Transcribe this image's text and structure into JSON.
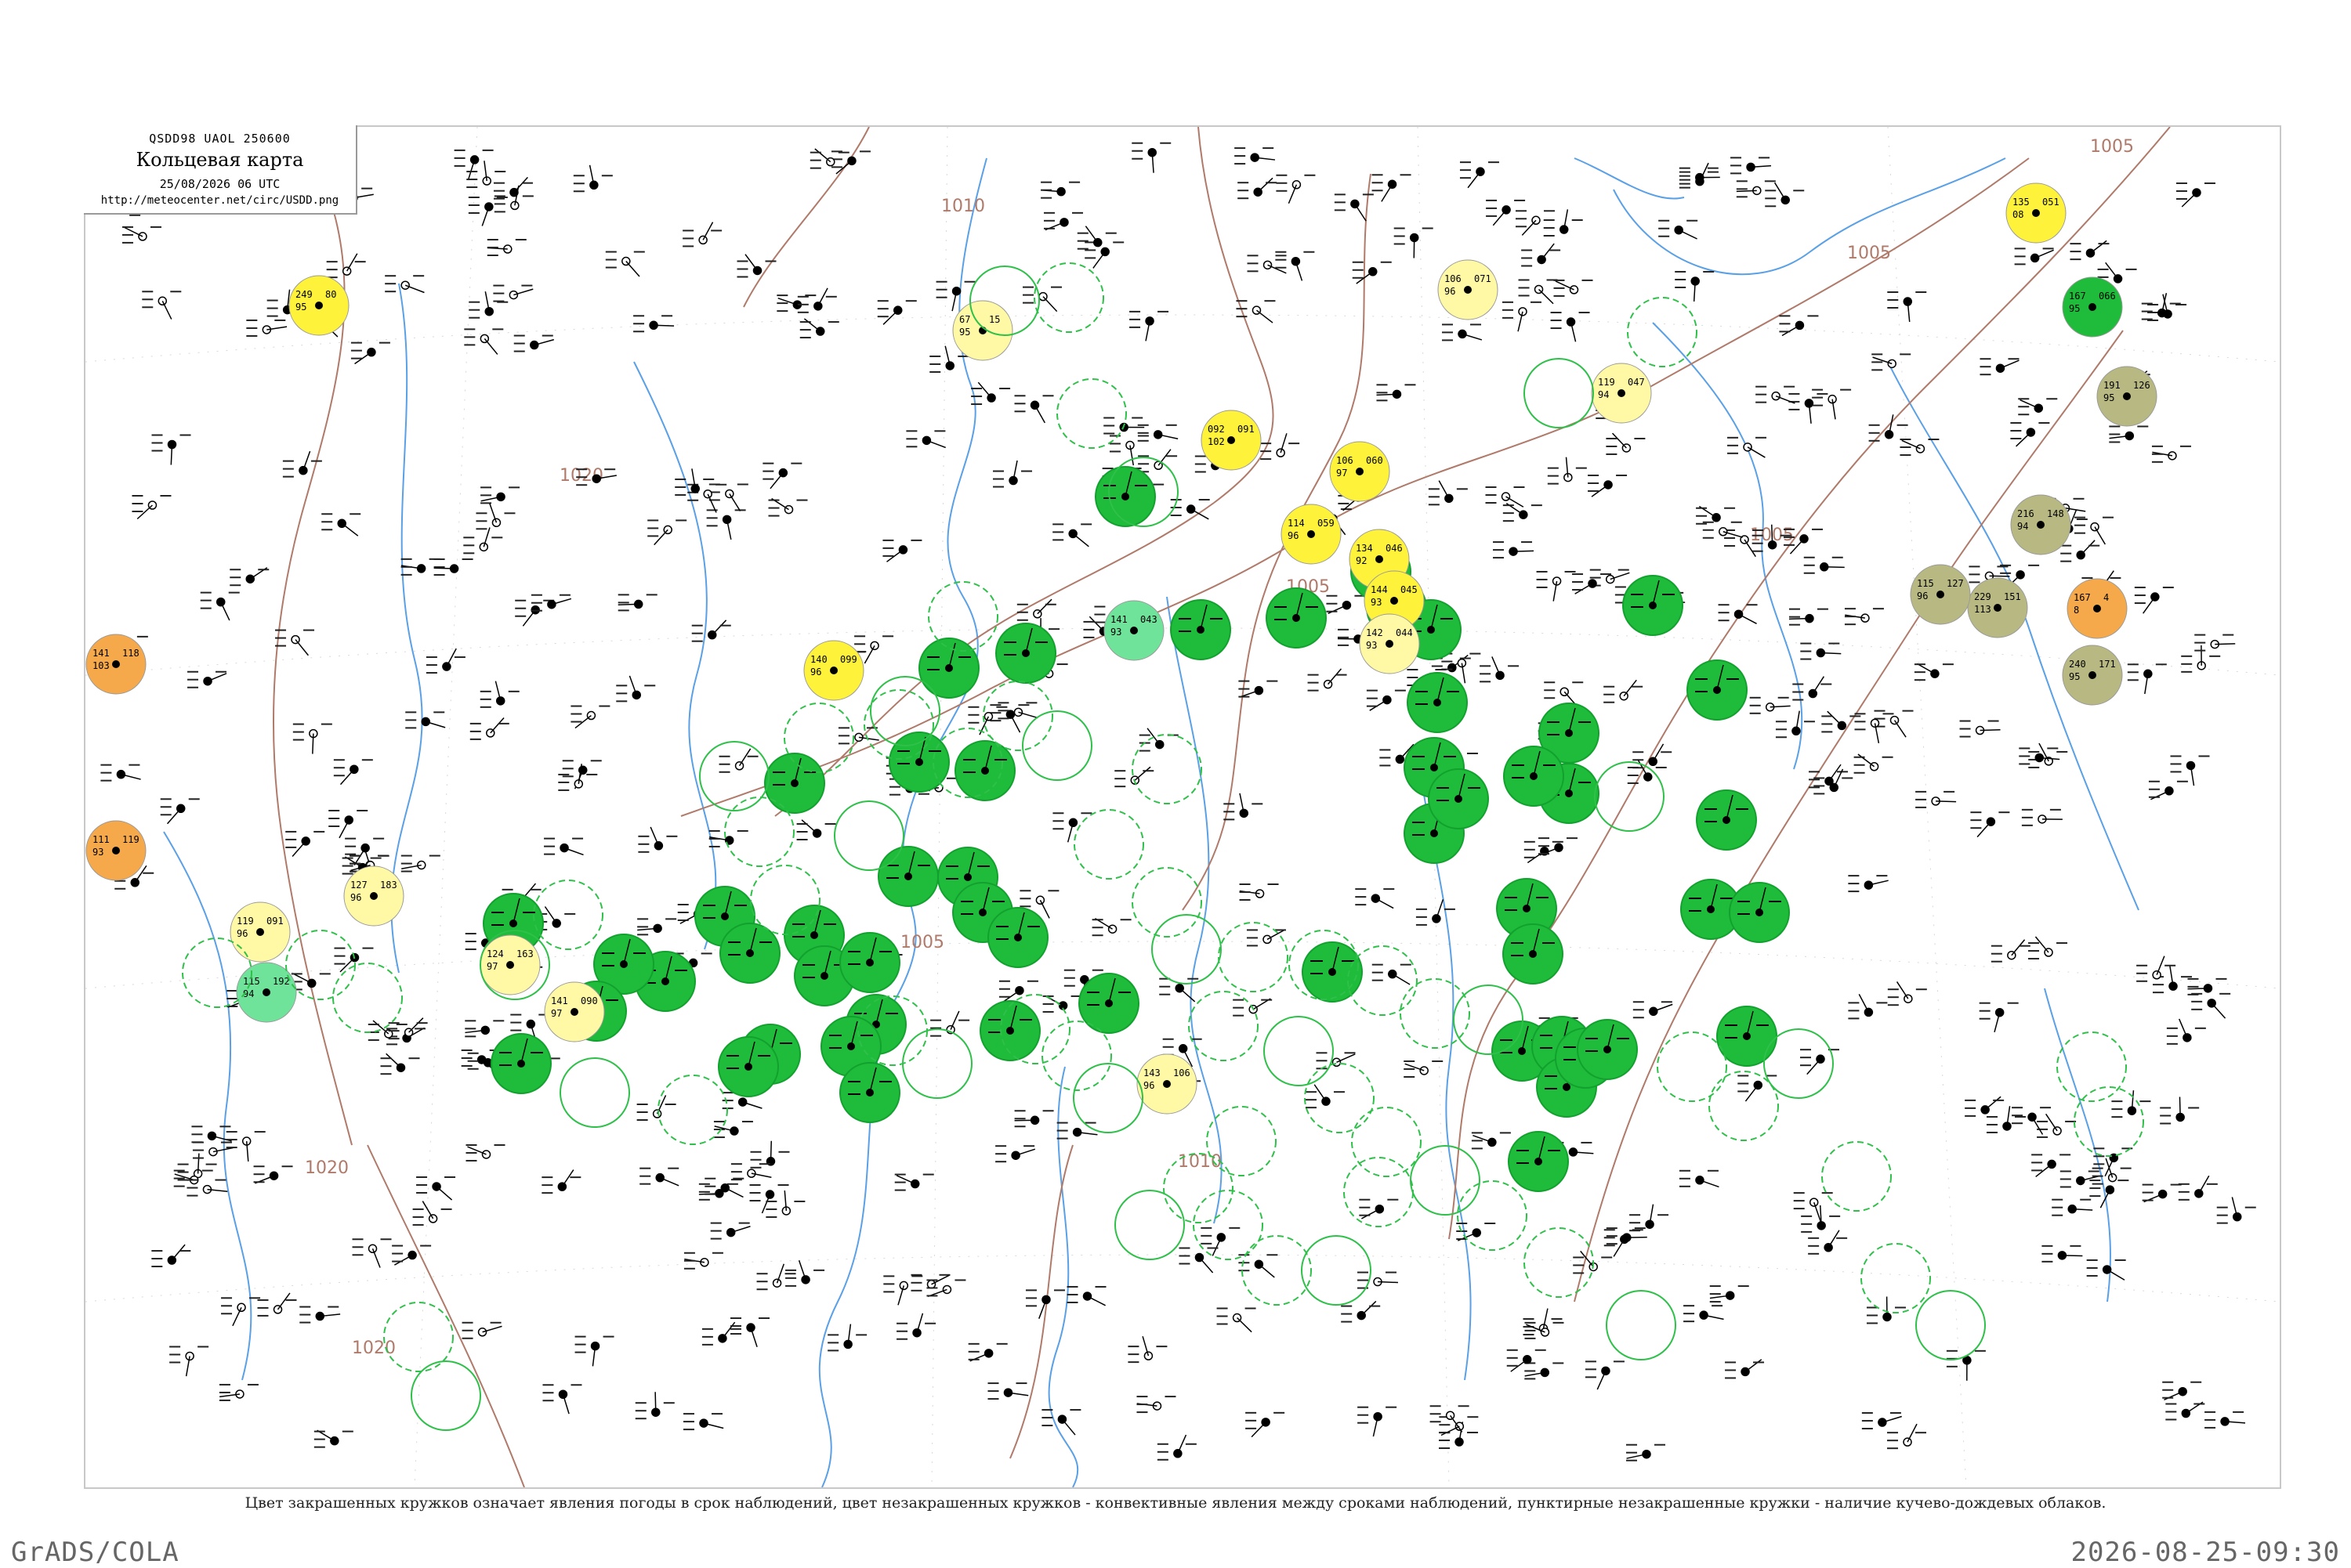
{
  "header": {
    "code": "QSDD98  UAOL  250600",
    "title": "Кольцевая карта",
    "date": "25/08/2026 06 UTC",
    "url": "http://meteocenter.net/circ/USDD.png"
  },
  "caption": "Цвет закрашенных кружков означает явления погоды в срок наблюдений, цвет незакрашенных кружков - конвективные явления между сроками наблюдений, пунктирные незакрашенные кружки - наличие кучево-дождевых облаков.",
  "footer": {
    "left": "GrADS/COLA",
    "right": "2026-08-25-09:30"
  },
  "colors": {
    "isobar": "#b07a6a",
    "river": "#5aa0e6",
    "station": "#000000",
    "green_fill": "#1fbb3a",
    "yellow_fill": "#fff23a",
    "pale_yellow_fill": "#fff9a6",
    "orange_fill": "#f5a94a",
    "olive_fill": "#b8b882",
    "light_green_fill": "#6fe39a",
    "ring_green": "#2fc04a"
  },
  "isobar_labels": [
    {
      "value": "1005",
      "anchor": "top-right"
    },
    {
      "value": "1005",
      "anchor": "upper-right"
    },
    {
      "value": "1005",
      "anchor": "center-right"
    },
    {
      "value": "1005",
      "anchor": "center"
    },
    {
      "value": "1005",
      "anchor": "lower-center"
    },
    {
      "value": "1010",
      "anchor": "top-center"
    },
    {
      "value": "1010",
      "anchor": "bottom-center"
    },
    {
      "value": "1020",
      "anchor": "upper-left"
    },
    {
      "value": "1020",
      "anchor": "lower-left"
    },
    {
      "value": "1020",
      "anchor": "bottom-left"
    }
  ],
  "stations": [
    {
      "pressure": "249",
      "temp": "80",
      "dew": "95",
      "fill": "yellow"
    },
    {
      "pressure": "141",
      "temp": "118",
      "dew": "103",
      "fill": "orange"
    },
    {
      "pressure": "111",
      "temp": "119",
      "dew": "93",
      "fill": "orange"
    },
    {
      "pressure": "135",
      "temp": "051",
      "dew": "08",
      "fill": "yellow"
    },
    {
      "pressure": "167",
      "temp": "066",
      "dew": "95",
      "fill": "green"
    },
    {
      "pressure": "191",
      "temp": "126",
      "dew": "95",
      "fill": "olive"
    },
    {
      "pressure": "092",
      "temp": "091",
      "dew": "102",
      "fill": "yellow"
    },
    {
      "pressure": "106",
      "temp": "060",
      "dew": "97",
      "fill": "yellow"
    },
    {
      "pressure": "114",
      "temp": "059",
      "dew": "96",
      "fill": "yellow"
    },
    {
      "pressure": "134",
      "temp": "046",
      "dew": "92",
      "fill": "yellow"
    },
    {
      "pressure": "144",
      "temp": "045",
      "dew": "93",
      "fill": "yellow"
    },
    {
      "pressure": "142",
      "temp": "044",
      "dew": "93",
      "fill": "pale_yellow"
    },
    {
      "pressure": "167",
      "temp": "4",
      "dew": "8",
      "fill": "orange"
    },
    {
      "pressure": "229",
      "temp": "151",
      "dew": "113",
      "fill": "olive"
    },
    {
      "pressure": "115",
      "temp": "127",
      "dew": "96",
      "fill": "olive"
    },
    {
      "pressure": "240",
      "temp": "171",
      "dew": "95",
      "fill": "olive"
    },
    {
      "pressure": "216",
      "temp": "148",
      "dew": "94",
      "fill": "olive"
    },
    {
      "pressure": "141",
      "temp": "043",
      "dew": "93",
      "fill": "light_green"
    },
    {
      "pressure": "115",
      "temp": "192",
      "dew": "94",
      "fill": "light_green"
    },
    {
      "pressure": "119",
      "temp": "091",
      "dew": "96",
      "fill": "pale_yellow"
    },
    {
      "pressure": "127",
      "temp": "183",
      "dew": "96",
      "fill": "pale_yellow"
    },
    {
      "pressure": "124",
      "temp": "163",
      "dew": "97",
      "fill": "pale_yellow"
    },
    {
      "pressure": "140",
      "temp": "099",
      "dew": "96",
      "fill": "yellow"
    },
    {
      "pressure": "143",
      "temp": "106",
      "dew": "96",
      "fill": "pale_yellow"
    },
    {
      "pressure": "141",
      "temp": "090",
      "dew": "97",
      "fill": "pale_yellow"
    },
    {
      "pressure": "106",
      "temp": "071",
      "dew": "96",
      "fill": "pale_yellow"
    },
    {
      "pressure": "119",
      "temp": "047",
      "dew": "94",
      "fill": "pale_yellow"
    },
    {
      "pressure": "67",
      "temp": "15",
      "dew": "95",
      "fill": "pale_yellow"
    }
  ]
}
